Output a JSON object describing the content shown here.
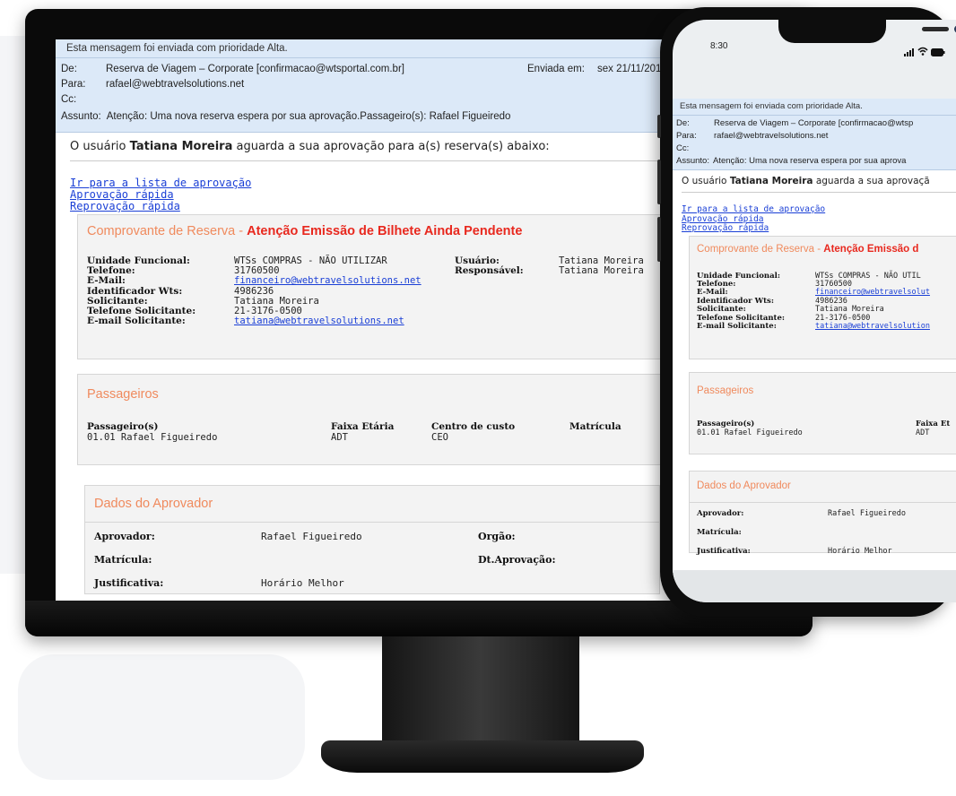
{
  "status_bar": {
    "time": "8:30",
    "signal_icon": "signal-icon",
    "wifi_icon": "wifi-icon",
    "battery_icon": "battery-icon"
  },
  "email": {
    "priority_notice": "Esta mensagem foi enviada com prioridade Alta.",
    "from_label": "De:",
    "from_value": "Reserva de Viagem – Corporate [confirmacao@wtsportal.com.br]",
    "sent_label": "Enviada em:",
    "sent_value": "sex 21/11/201",
    "to_label": "Para:",
    "to_value": "rafael@webtravelsolutions.net",
    "cc_label": "Cc:",
    "subject_label": "Assunto:",
    "subject_value": "Atenção: Uma nova reserva espera por sua aprovação.Passageiro(s): Rafael Figueiredo",
    "intro_prefix": "O usuário",
    "intro_user": "Tatiana Moreira",
    "intro_suffix": "aguarda a sua aprovação para a(s) reserva(s) abaixo:",
    "links": [
      "Ir para a lista de aprovação",
      "Aprovação rápida",
      "Reprovação rápida"
    ],
    "voucher": {
      "title": "Comprovante de Reserva",
      "separator": " - ",
      "alert": "Atenção Emissão de Bilhete Ainda Pendente",
      "fields": [
        {
          "label": "Unidade Funcional:",
          "value": "WTSs COMPRAS - NÃO UTILIZAR",
          "is_link": false
        },
        {
          "label": "Telefone:",
          "value": "31760500",
          "is_link": false
        },
        {
          "label": "E-Mail:",
          "value": "financeiro@webtravelsolutions.net",
          "is_link": true
        },
        {
          "label": "Identificador Wts:",
          "value": "4986236",
          "is_link": false
        },
        {
          "label": "Solicitante:",
          "value": "Tatiana Moreira",
          "is_link": false
        },
        {
          "label": "Telefone Solicitante:",
          "value": "21-3176-0500",
          "is_link": false
        },
        {
          "label": "E-mail Solicitante:",
          "value": "tatiana@webtravelsolutions.net",
          "is_link": true
        }
      ],
      "right_fields": [
        {
          "label": "Usuário:",
          "value": "Tatiana Moreira"
        },
        {
          "label": "Responsável:",
          "value": "Tatiana Moreira"
        }
      ]
    },
    "passengers": {
      "title": "Passageiros",
      "headers": [
        "Passageiro(s)",
        "Faixa Etária",
        "Centro de custo",
        "Matrícula"
      ],
      "rows": [
        [
          "01.01 Rafael  Figueiredo",
          "ADT",
          "CEO",
          ""
        ]
      ]
    },
    "approver": {
      "title": "Dados do Aprovador",
      "rows": [
        {
          "label": "Aprovador:",
          "value": "Rafael Figueiredo",
          "label2": "Orgão:",
          "value2": ""
        },
        {
          "label": "Matrícula:",
          "value": "",
          "label2": "Dt.Aprovação:",
          "value2": ""
        },
        {
          "label": "Justificativa:",
          "value": "Horário Melhor",
          "label2": "",
          "value2": ""
        }
      ]
    },
    "phone_from_value": "Reserva de Viagem – Corporate [confirmacao@wtsp",
    "phone_subject_value": "Atenção: Uma nova reserva espera por sua aprova",
    "phone_intro_suffix": "aguarda a sua aprovaçã",
    "phone_voucher_alert": "Atenção Emissão d",
    "phone_field_values": [
      "WTSs COMPRAS - NÃO UTIL",
      "31760500",
      "financeiro@webtravelsolut",
      "4986236",
      "Tatiana Moreira",
      "21-3176-0500",
      "tatiana@webtravelsolution"
    ],
    "phone_pass_header2": "Faixa Et"
  }
}
